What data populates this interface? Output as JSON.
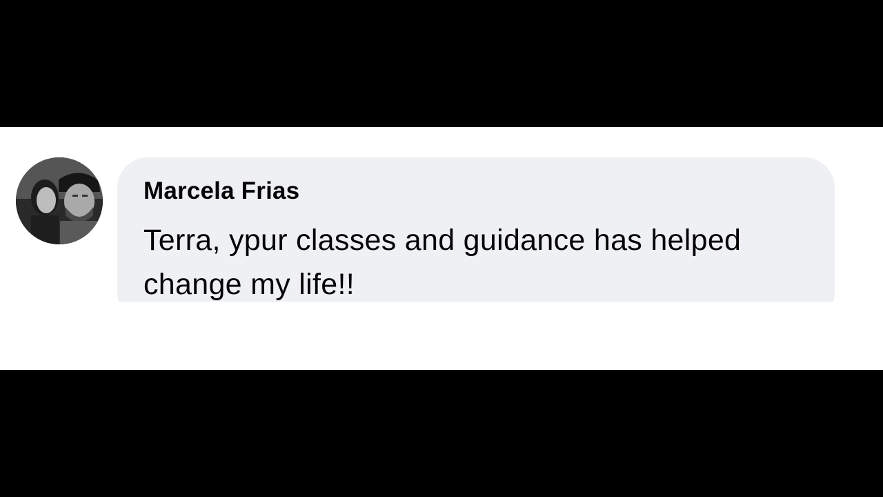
{
  "comment": {
    "author": "Marcela Frias",
    "text": "Terra, ypur classes and guidance has helped change my life!!",
    "avatar_icon": "profile-photo",
    "bubble_color": "#eff0f3",
    "text_color": "#050505"
  }
}
